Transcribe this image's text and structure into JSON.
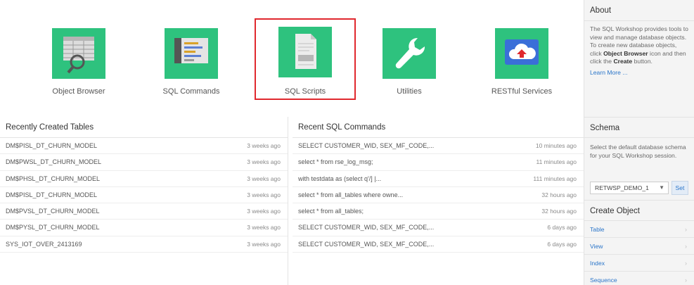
{
  "tiles": [
    {
      "label": "Object Browser",
      "icon": "magnifier-grid-icon"
    },
    {
      "label": "SQL Commands",
      "icon": "command-window-icon"
    },
    {
      "label": "SQL Scripts",
      "icon": "script-file-icon"
    },
    {
      "label": "Utilities",
      "icon": "wrench-icon"
    },
    {
      "label": "RESTful Services",
      "icon": "cloud-upload-icon"
    }
  ],
  "recent_tables": {
    "title": "Recently Created Tables",
    "rows": [
      {
        "name": "DM$PISL_DT_CHURN_MODEL",
        "time": "3 weeks ago"
      },
      {
        "name": "DM$PWSL_DT_CHURN_MODEL",
        "time": "3 weeks ago"
      },
      {
        "name": "DM$PHSL_DT_CHURN_MODEL",
        "time": "3 weeks ago"
      },
      {
        "name": "DM$PISL_DT_CHURN_MODEL",
        "time": "3 weeks ago"
      },
      {
        "name": "DM$PVSL_DT_CHURN_MODEL",
        "time": "3 weeks ago"
      },
      {
        "name": "DM$PYSL_DT_CHURN_MODEL",
        "time": "3 weeks ago"
      },
      {
        "name": "SYS_IOT_OVER_2413169",
        "time": "3 weeks ago"
      }
    ]
  },
  "recent_sql": {
    "title": "Recent SQL Commands",
    "rows": [
      {
        "cmd": "SELECT CUSTOMER_WID, SEX_MF_CODE,...",
        "time": "10 minutes ago"
      },
      {
        "cmd": "select * from rse_log_msg;",
        "time": "11 minutes ago"
      },
      {
        "cmd": "with testdata as (select q'/] |...",
        "time": "111 minutes ago"
      },
      {
        "cmd": "select * from all_tables where owne...",
        "time": "32 hours ago"
      },
      {
        "cmd": "select * from all_tables;",
        "time": "32 hours ago"
      },
      {
        "cmd": "SELECT CUSTOMER_WID, SEX_MF_CODE,...",
        "time": "6 days ago"
      },
      {
        "cmd": "SELECT CUSTOMER_WID, SEX_MF_CODE,...",
        "time": "6 days ago"
      }
    ]
  },
  "sidebar": {
    "about_title": "About",
    "about_text_1": "The SQL Workshop provides tools to view and manage database objects. To create new database objects, click ",
    "about_bold_1": "Object Browser",
    "about_text_2": " icon and then click the ",
    "about_bold_2": "Create",
    "about_text_3": " button.",
    "learn_more": "Learn More ...",
    "schema_title": "Schema",
    "schema_text": "Select the default database schema for your SQL Workshop session.",
    "schema_value": "RETWSP_DEMO_1",
    "set_label": "Set",
    "create_title": "Create Object",
    "create_items": [
      "Table",
      "View",
      "Index",
      "Sequence"
    ]
  },
  "colors": {
    "tile_green": "#2ec27e",
    "selected_outline": "#e0282e",
    "link_blue": "#2a75c9"
  }
}
